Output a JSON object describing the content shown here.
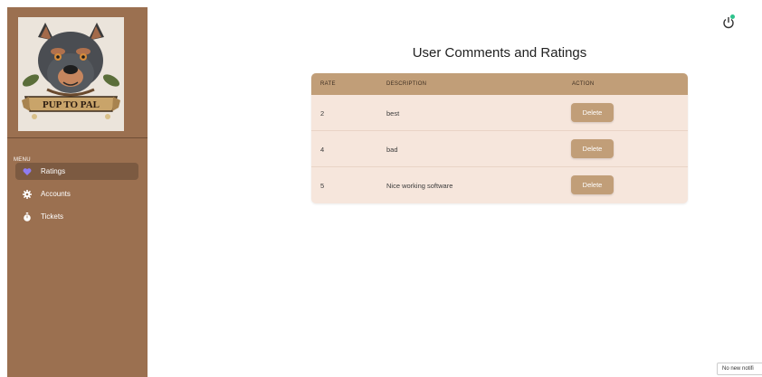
{
  "sidebar": {
    "logo_text": "PUP TO PAL",
    "menu_heading": "MENU",
    "items": [
      {
        "label": "Ratings",
        "icon": "heart-icon",
        "active": true
      },
      {
        "label": "Accounts",
        "icon": "gear-icon",
        "active": false
      },
      {
        "label": "Tickets",
        "icon": "stopwatch-icon",
        "active": false
      }
    ]
  },
  "header": {
    "power_icon": "power-icon",
    "notification_color": "#2dc38c"
  },
  "main": {
    "title": "User Comments and Ratings",
    "table": {
      "columns": [
        "RATE",
        "DESCRIPTION",
        "ACTION"
      ],
      "rows": [
        {
          "rate": "2",
          "description": "best",
          "action": "Delete"
        },
        {
          "rate": "4",
          "description": "bad",
          "action": "Delete"
        },
        {
          "rate": "5",
          "description": "Nice working software",
          "action": "Delete"
        }
      ]
    }
  },
  "toast": {
    "text": "No new notifi"
  },
  "colors": {
    "sidebar_bg": "#9b7050",
    "active_item_bg": "#7c5a41",
    "table_header_bg": "#c19e78",
    "table_row_bg": "#f6e6dc",
    "button_bg": "#c19e78",
    "active_icon_color": "#8f7cf0"
  }
}
